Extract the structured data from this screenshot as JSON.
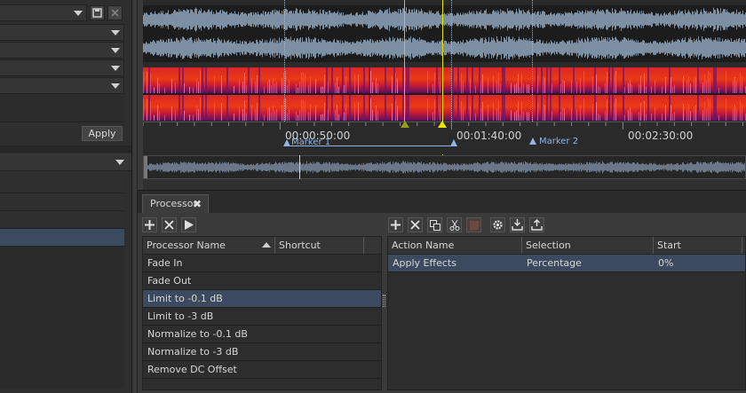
{
  "left_panel": {
    "apply_label": "Apply"
  },
  "ruler": {
    "ticks": [
      "00:00:50:00",
      "00:01:40:00",
      "00:02:30:00"
    ],
    "markers": [
      "Marker 1",
      "Marker 2"
    ]
  },
  "processor": {
    "tab_label": "Processor",
    "close_glyph": "✖",
    "list_columns": [
      "Processor Name",
      "Shortcut"
    ],
    "items": [
      "Fade In",
      "Fade Out",
      "Limit to -0.1 dB",
      "Limit to -3 dB",
      "Normalize to -0.1 dB",
      "Normalize to -3 dB",
      "Remove DC Offset"
    ],
    "selected_index": 2,
    "action_columns": [
      "Action Name",
      "Selection",
      "Start"
    ],
    "actions": [
      {
        "name": "Apply Effects",
        "selection": "Percentage",
        "start": "0%"
      }
    ]
  },
  "colors": {
    "selection": "#3b4a5e",
    "waveform": "#7d8fa3",
    "playhead": "#e6e600",
    "marker": "#8fb4e8"
  }
}
